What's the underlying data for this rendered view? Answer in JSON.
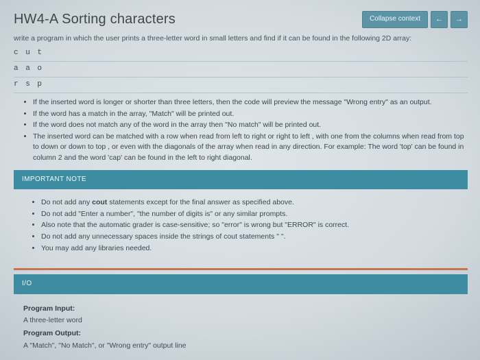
{
  "header": {
    "title": "HW4-A Sorting characters",
    "collapse_label": "Collapse context",
    "prev_icon": "←",
    "next_icon": "→"
  },
  "intro": "write a program in which the user prints a three-letter word in small letters and find if it can be found in the following 2D array:",
  "array_rows": [
    "c u t",
    "a a o",
    "r s p"
  ],
  "rules": [
    "If the inserted word is longer or shorter than three letters, then the code will preview the message \"Wrong entry\" as an output.",
    "If the word has a match in the array, \"Match\" will be printed out.",
    "If the word does not match any of the word in the array then \"No match\" will be printed out.",
    "The inserted word can be matched with a row when read from left to right or right to left , with one from the columns when read from top to down or down to top , or even with the diagonals of the array when read in any direction. For example: The word 'top' can be found in column 2 and the word 'cap' can be found in the left to right diagonal."
  ],
  "important": {
    "heading": "IMPORTANT NOTE",
    "items_pre": [
      "Do not add any "
    ],
    "cout_word": "cout",
    "items_post": [
      " statements except for the final answer as specified above."
    ],
    "items_rest": [
      "Do not add \"Enter a number\", \"the number of digits is\" or any similar prompts.",
      "Also note that the automatic grader is case-sensitive; so \"error\" is wrong but \"ERROR\" is correct.",
      "Do not add any unnecessary spaces inside the strings of cout statements \" \".",
      "You may add any libraries needed."
    ]
  },
  "io": {
    "heading": "I/O",
    "input_label": "Program Input:",
    "input_value": "A three-letter word",
    "output_label": "Program Output:",
    "output_value": "A \"Match\", \"No Match\", or \"Wrong entry\" output line"
  }
}
